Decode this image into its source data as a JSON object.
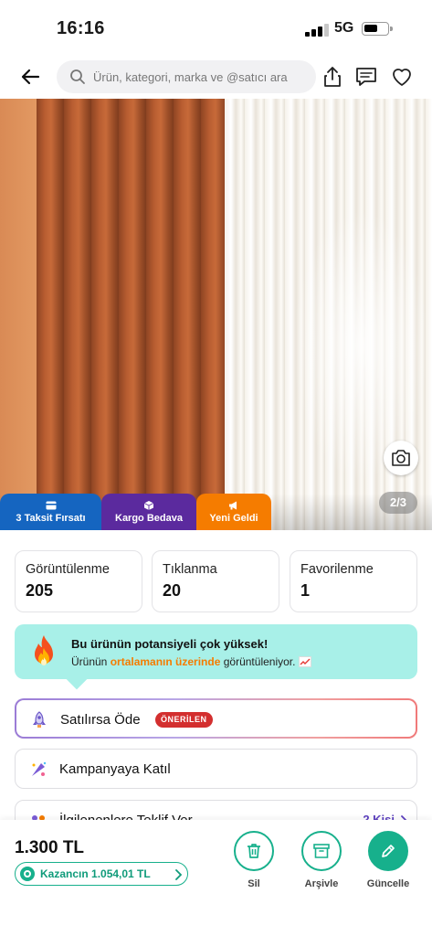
{
  "status_bar": {
    "time": "16:16",
    "network": "5G"
  },
  "header": {
    "search_placeholder": "Ürün, kategori, marka ve @satıcı ara",
    "icons": [
      "back-arrow-icon",
      "search-icon",
      "share-icon",
      "message-icon",
      "heart-icon"
    ]
  },
  "product_image": {
    "page_indicator": "2/3",
    "badges": [
      {
        "label": "3 Taksit Fırsatı",
        "color": "#1565c0",
        "icon": "card-icon"
      },
      {
        "label": "Kargo Bedava",
        "color": "#5b2a9e",
        "icon": "box-icon"
      },
      {
        "label": "Yeni Geldi",
        "color": "#f57c00",
        "icon": "megaphone-icon"
      }
    ]
  },
  "stats": [
    {
      "label": "Görüntülenme",
      "value": "205"
    },
    {
      "label": "Tıklanma",
      "value": "20"
    },
    {
      "label": "Favorilenme",
      "value": "1"
    }
  ],
  "potential": {
    "title": "Bu ürünün potansiyeli çok yüksek!",
    "desc_prefix": "Ürünün ",
    "desc_highlight": "ortalamanın üzerinde",
    "desc_suffix": " görüntüleniyor.",
    "color": "#a8f0e8",
    "highlight_color": "#f57c00"
  },
  "actions": {
    "pay_if_sold": {
      "label": "Satılırsa Öde",
      "badge": "ÖNERİLEN"
    },
    "campaign": {
      "label": "Kampanyaya Katıl"
    },
    "offer": {
      "label": "İlgilenenlere Teklif Ver",
      "count": "2 Kişi"
    }
  },
  "bottom_bar": {
    "price": "1.300 TL",
    "earnings": "Kazancın 1.054,01 TL",
    "buttons": [
      {
        "label": "Sil",
        "icon": "trash-icon"
      },
      {
        "label": "Arşivle",
        "icon": "archive-icon"
      },
      {
        "label": "Güncelle",
        "icon": "pencil-icon"
      }
    ],
    "accent": "#17b08c"
  }
}
